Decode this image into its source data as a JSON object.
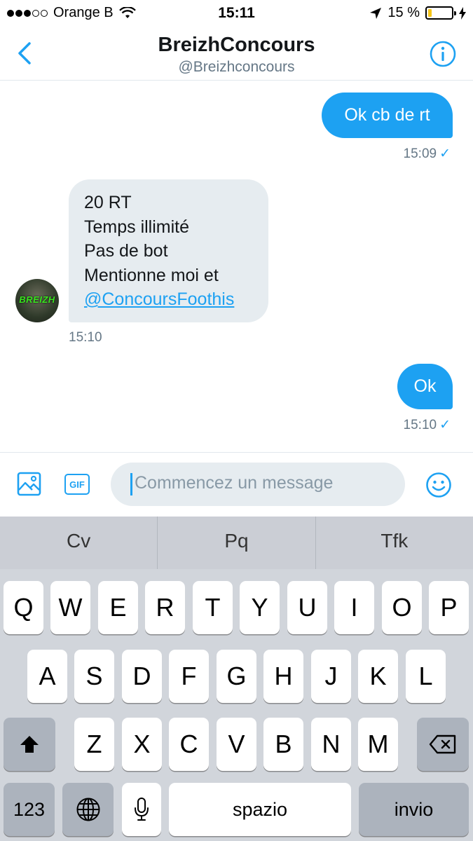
{
  "status_bar": {
    "carrier": "Orange B",
    "time": "15:11",
    "battery_percent": "15 %",
    "battery_level": 0.15
  },
  "header": {
    "title": "BreizhConcours",
    "handle": "@Breizhconcours",
    "back_icon": "chevron-left-icon",
    "info_icon": "info-icon"
  },
  "messages": [
    {
      "direction": "sent",
      "text": "Ok cb de rt",
      "time": "15:09",
      "check": "✓"
    },
    {
      "direction": "received",
      "lines": [
        "20 RT",
        "Temps illimité",
        "Pas de bot",
        "Mentionne moi et"
      ],
      "mention": "@ConcoursFoothis",
      "time": "15:10",
      "avatar_text": "BREIZH"
    },
    {
      "direction": "sent",
      "text": "Ok",
      "time": "15:10",
      "check": "✓"
    }
  ],
  "compose": {
    "placeholder": "Commencez un message",
    "gif_label": "GIF",
    "image_icon": "image-icon",
    "emoji_icon": "emoji-icon"
  },
  "keyboard": {
    "predictions": [
      "Cv",
      "Pq",
      "Tfk"
    ],
    "row1": [
      "Q",
      "W",
      "E",
      "R",
      "T",
      "Y",
      "U",
      "I",
      "O",
      "P"
    ],
    "row2": [
      "A",
      "S",
      "D",
      "F",
      "G",
      "H",
      "J",
      "K",
      "L"
    ],
    "row3": [
      "Z",
      "X",
      "C",
      "V",
      "B",
      "N",
      "M"
    ],
    "numbers_label": "123",
    "space_label": "spazio",
    "return_label": "invio"
  },
  "colors": {
    "accent": "#1da1f2",
    "bubble_received": "#e6ecf0",
    "text_secondary": "#657786"
  }
}
